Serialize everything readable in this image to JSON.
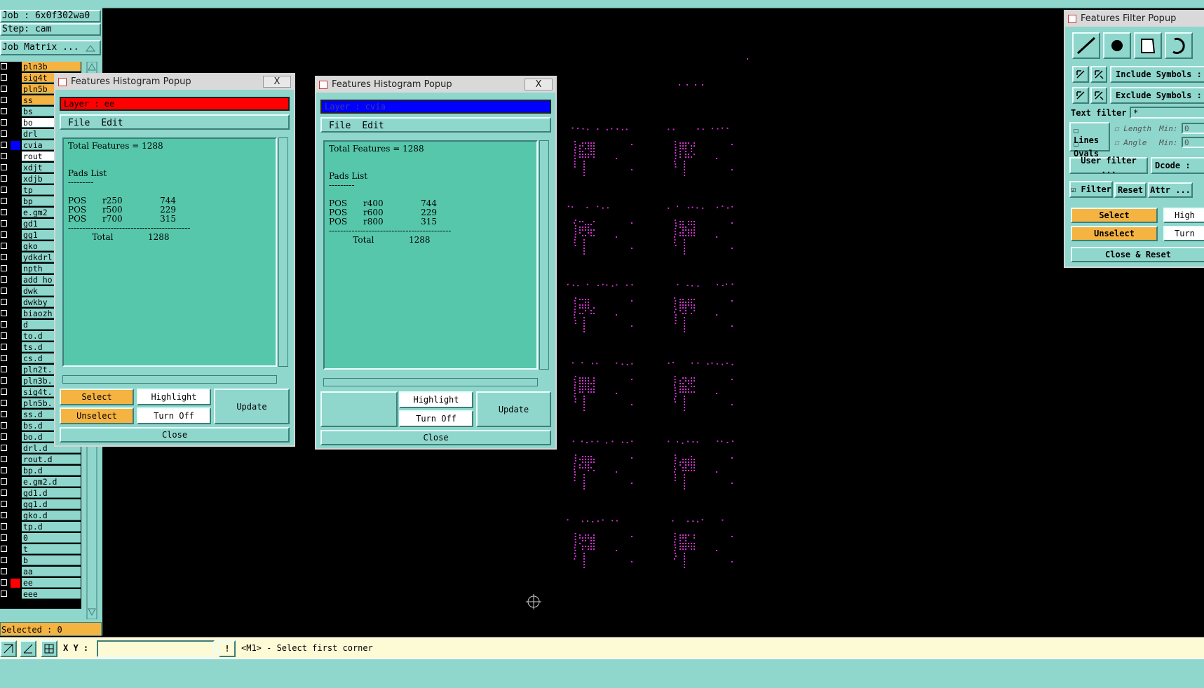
{
  "left_panel": {
    "job_label": "Job : 6x0f302wa0",
    "step_label": "Step: cam",
    "job_matrix_button": "Job Matrix ...",
    "selected_label": "Selected : 0",
    "layers": [
      {
        "name": "pln3b",
        "color": "orange",
        "swatch": "#000"
      },
      {
        "name": "sig4t",
        "color": "orange",
        "swatch": "#000"
      },
      {
        "name": "pln5b",
        "color": "orange",
        "swatch": "#000"
      },
      {
        "name": "ss",
        "color": "orange",
        "swatch": "#000"
      },
      {
        "name": "bs",
        "color": "teal",
        "swatch": "#000"
      },
      {
        "name": "bo",
        "color": "white",
        "swatch": "#000"
      },
      {
        "name": "drl",
        "color": "teal",
        "swatch": "#000"
      },
      {
        "name": "cvia",
        "color": "teal",
        "swatch": "#0000ff"
      },
      {
        "name": "rout",
        "color": "white",
        "swatch": "#000"
      },
      {
        "name": "xdjt",
        "color": "teal",
        "swatch": "#000"
      },
      {
        "name": "xdjb",
        "color": "teal",
        "swatch": "#000"
      },
      {
        "name": "tp",
        "color": "teal",
        "swatch": "#000"
      },
      {
        "name": "bp",
        "color": "teal",
        "swatch": "#000"
      },
      {
        "name": "e.gm2",
        "color": "teal",
        "swatch": "#000"
      },
      {
        "name": "gd1",
        "color": "teal",
        "swatch": "#000"
      },
      {
        "name": "gg1",
        "color": "teal",
        "swatch": "#000"
      },
      {
        "name": "gko",
        "color": "teal",
        "swatch": "#000"
      },
      {
        "name": "ydkdrl",
        "color": "teal",
        "swatch": "#000"
      },
      {
        "name": "npth",
        "color": "teal",
        "swatch": "#000"
      },
      {
        "name": "add_ho",
        "color": "teal",
        "swatch": "#000"
      },
      {
        "name": "dwk",
        "color": "teal",
        "swatch": "#000"
      },
      {
        "name": "dwkby",
        "color": "teal",
        "swatch": "#000"
      },
      {
        "name": "biaozh",
        "color": "teal",
        "swatch": "#000"
      },
      {
        "name": "d",
        "color": "teal",
        "swatch": "#000"
      },
      {
        "name": "to.d",
        "color": "teal",
        "swatch": "#000"
      },
      {
        "name": "ts.d",
        "color": "teal",
        "swatch": "#000"
      },
      {
        "name": "cs.d",
        "color": "teal",
        "swatch": "#000"
      },
      {
        "name": "pln2t.",
        "color": "teal",
        "swatch": "#000"
      },
      {
        "name": "pln3b.",
        "color": "teal",
        "swatch": "#000"
      },
      {
        "name": "sig4t.",
        "color": "teal",
        "swatch": "#000"
      },
      {
        "name": "pln5b.",
        "color": "teal",
        "swatch": "#000"
      },
      {
        "name": "ss.d",
        "color": "teal",
        "swatch": "#000"
      },
      {
        "name": "bs.d",
        "color": "teal",
        "swatch": "#000"
      },
      {
        "name": "bo.d",
        "color": "teal",
        "swatch": "#000"
      },
      {
        "name": "drl.d",
        "color": "teal",
        "swatch": "#000"
      },
      {
        "name": "rout.d",
        "color": "teal",
        "swatch": "#000"
      },
      {
        "name": "bp.d",
        "color": "teal",
        "swatch": "#000"
      },
      {
        "name": "e.gm2.d",
        "color": "teal",
        "swatch": "#000"
      },
      {
        "name": "gd1.d",
        "color": "teal",
        "swatch": "#000"
      },
      {
        "name": "gg1.d",
        "color": "teal",
        "swatch": "#000"
      },
      {
        "name": "gko.d",
        "color": "teal",
        "swatch": "#000"
      },
      {
        "name": "tp.d",
        "color": "teal",
        "swatch": "#000"
      },
      {
        "name": "0",
        "color": "teal",
        "swatch": "#000"
      },
      {
        "name": "t",
        "color": "teal",
        "swatch": "#000"
      },
      {
        "name": "b",
        "color": "teal",
        "swatch": "#000"
      },
      {
        "name": "aa",
        "color": "teal",
        "swatch": "#000"
      },
      {
        "name": "ee",
        "color": "teal",
        "swatch": "#ff0000"
      },
      {
        "name": "eee",
        "color": "teal",
        "swatch": "#000"
      }
    ]
  },
  "histogram1": {
    "title": "Features Histogram Popup",
    "close_x": "X",
    "layer_label": "Layer :  ee",
    "layer_color": "#ff0000",
    "menu_file": "File",
    "menu_edit": "Edit",
    "text": "Total Features = 1288\n\n\nPads List\n---------\n\nPOS      r250              744\nPOS      r500              229\nPOS      r700              315\n-------------------------------------------\n         Total             1288",
    "select": "Select",
    "highlight": "Highlight",
    "unselect": "Unselect",
    "turn_off": "Turn Off",
    "update": "Update",
    "close": "Close"
  },
  "histogram2": {
    "title": "Features Histogram Popup",
    "close_x": "X",
    "layer_label": "Layer :  cvia",
    "layer_color": "#0000ff",
    "menu_file": "File",
    "menu_edit": "Edit",
    "text": "Total Features = 1288\n\n\nPads List\n---------\n\nPOS      r400              744\nPOS      r600              229\nPOS      r800              315\n-------------------------------------------\n         Total             1288",
    "highlight": "Highlight",
    "turn_off": "Turn Off",
    "update": "Update",
    "close": "Close"
  },
  "filter_popup": {
    "title": "Features Filter Popup",
    "include_symbols": "Include Symbols :",
    "exclude_symbols": "Exclude Symbols :",
    "text_filter_label": "Text filter",
    "text_filter_value": "*",
    "lines": "Lines",
    "ovals": "Ovals",
    "length": "Length",
    "angle": "Angle",
    "min1": "Min:",
    "min2": "Min:",
    "min1_value": "0",
    "min2_value": "0",
    "user_filter": "User filter ...",
    "dcode": "Dcode :",
    "filter": "Filter",
    "reset": "Reset",
    "attr": "Attr ...",
    "select": "Select",
    "high": "High",
    "unselect": "Unselect",
    "turn": "Turn",
    "close_reset": "Close & Reset"
  },
  "status": {
    "xy_label": "X Y :",
    "xy_value": "",
    "message": "<M1> - Select first corner"
  },
  "colors": {
    "teal": "#8fd6cc",
    "text_area": "#56c7ab",
    "orange": "#f5b342",
    "magenta_features": "#d030d0"
  }
}
